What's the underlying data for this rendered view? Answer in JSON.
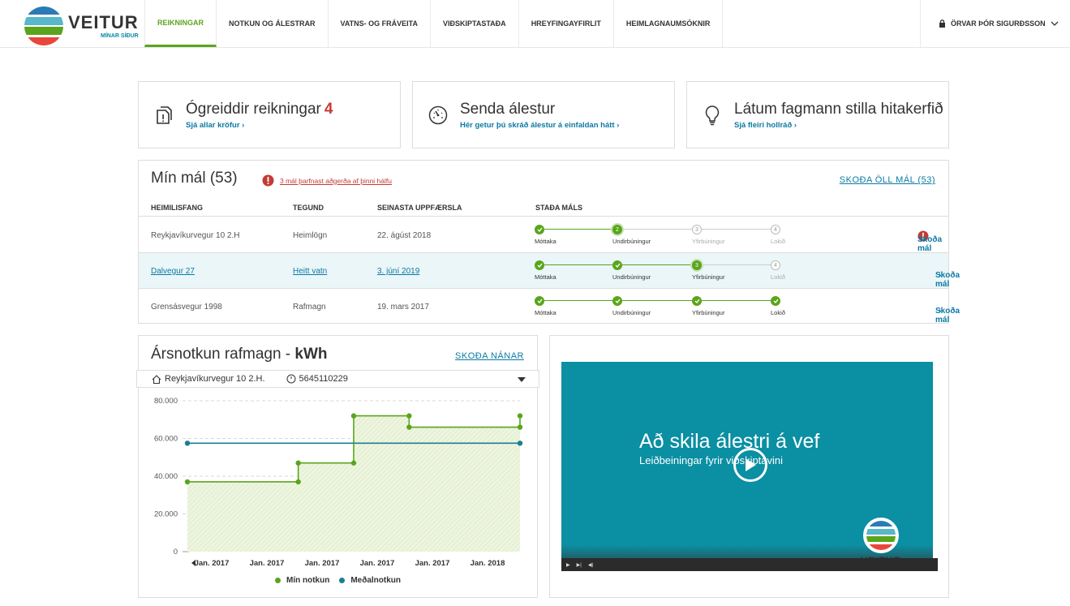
{
  "header": {
    "brand": "VEITUR",
    "brand_sub": "MÍNAR SÍÐUR",
    "nav": [
      "REIKNINGAR",
      "NOTKUN OG ÁLESTRAR",
      "VATNS- OG FRÁVEITA",
      "VIÐSKIPTASTAÐA",
      "HREYFINGAYFIRLIT",
      "HEIMLAGNAUMSÓKNIR"
    ],
    "active_nav": 0,
    "user": "ÖRVAR ÞÓR SIGURÐSSON"
  },
  "quick": {
    "bills": {
      "title": "Ógreiddir reikningar",
      "count": "4",
      "link": "Sjá allar kröfur"
    },
    "reading": {
      "title": "Senda álestur",
      "link": "Hér getur þú skráð álestur á einfaldan hátt"
    },
    "tips": {
      "title": "Látum fagmann stilla hitakerfið",
      "link": "Sjá fleiri hollráð"
    }
  },
  "cases": {
    "title": "Mín mál (53)",
    "warning": "3 mál þarfnast aðgerða af þinni hálfu",
    "all_link": "SKOÐA ÖLL MÁL (53)",
    "headers": {
      "address": "HEIMILISFANG",
      "type": "TEGUND",
      "updated": "SEINASTA UPPFÆRSLA",
      "status": "STAÐA MÁLS"
    },
    "step_labels": [
      "Móttaka",
      "Undirbúningur",
      "Yfirbúningur",
      "Lokið"
    ],
    "view_label": "Skoða mál",
    "rows": [
      {
        "address": "Reykjavíkurvegur 10 2.H",
        "type": "Heimlögn",
        "updated": "22. ágúst 2018",
        "progress": 2,
        "alert": true
      },
      {
        "address": "Dalvegur 27",
        "type": "Heitt vatn",
        "updated": "3. júní 2019",
        "progress": 3,
        "alert": false
      },
      {
        "address": "Grensásvegur 1998",
        "type": "Rafmagn",
        "updated": "19. mars 2017",
        "progress": 4,
        "alert": false
      }
    ]
  },
  "usage": {
    "title": "Ársnotkun rafmagn - ",
    "unit": "kWh",
    "link": "SKOÐA NÁNAR",
    "address": "Reykjavíkurvegur 10 2.H.",
    "meter": "5645110229"
  },
  "chart_data": {
    "type": "area",
    "categories": [
      "Jan. 2017",
      "Jan. 2017",
      "Jan. 2017",
      "Jan. 2017",
      "Jan. 2017",
      "Jan. 2018"
    ],
    "ylim": [
      0,
      80000
    ],
    "yticks": [
      "0",
      "20.000",
      "40.000",
      "60.000",
      "80.000"
    ],
    "grid": true,
    "legend_position": "bottom",
    "series": [
      {
        "name": "Mín notkun",
        "color": "#5aa51c",
        "x": [
          0,
          2,
          2,
          3,
          3,
          4,
          4,
          6,
          6
        ],
        "values": [
          37000,
          37000,
          47000,
          47000,
          72000,
          72000,
          66000,
          66000,
          72000
        ]
      },
      {
        "name": "Meðalnotkun",
        "color": "#1a7f94",
        "x": [
          0,
          6
        ],
        "values": [
          57500,
          57500
        ]
      }
    ]
  },
  "video": {
    "title": "Að skila álestri á vef",
    "subtitle": "Leiðbeiningar fyrir viðskiptavini",
    "logo_text": "VEITUR"
  },
  "colors": {
    "accent": "#5aa51c",
    "link": "#0b7aa3",
    "alert": "#c43b35",
    "teal": "#1a7f94"
  }
}
